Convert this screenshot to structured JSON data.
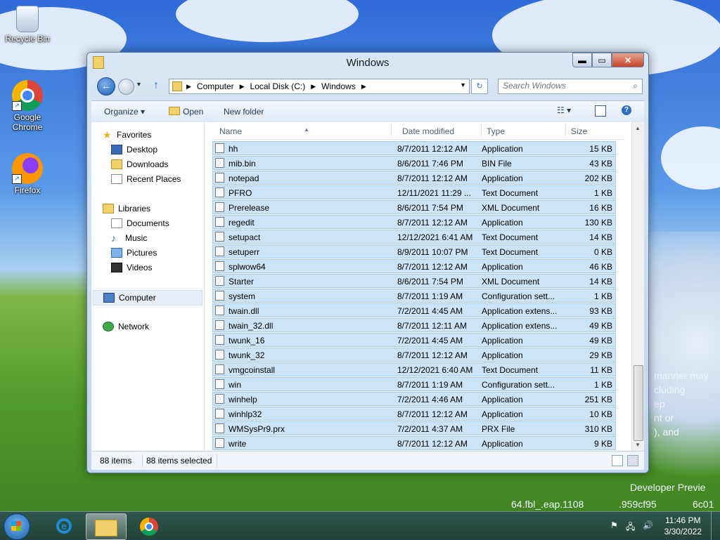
{
  "desktop": {
    "icons": [
      {
        "label": "Recycle Bin"
      },
      {
        "label": "Google Chrome"
      },
      {
        "label": "Firefox"
      }
    ],
    "watermark": {
      "lines": [
        "manner may",
        "cluding",
        "ep",
        "nt or",
        "), and"
      ],
      "build_line1": "Developer Previe",
      "build_line2": "64.fbl_.eap.1108",
      "build_line3": ".959cf95",
      "build_line4": "6c01"
    }
  },
  "window": {
    "title": "Windows",
    "controls": {
      "minimize": "▬",
      "maximize": "▭",
      "close": "✕"
    },
    "address": {
      "crumbs": [
        "Computer",
        "Local Disk (C:)",
        "Windows"
      ]
    },
    "search": {
      "placeholder": "Search Windows"
    },
    "toolbar": {
      "organize": "Organize ▾",
      "open": "Open",
      "new_folder": "New folder",
      "views": "☷ ▾",
      "help": "?"
    },
    "nav": {
      "favorites": "Favorites",
      "desktop": "Desktop",
      "downloads": "Downloads",
      "recent_places": "Recent Places",
      "libraries": "Libraries",
      "documents": "Documents",
      "music": "Music",
      "pictures": "Pictures",
      "videos": "Videos",
      "computer": "Computer",
      "network": "Network"
    },
    "columns": {
      "name": "Name",
      "date": "Date modified",
      "type": "Type",
      "size": "Size"
    },
    "files": [
      {
        "name": "hh",
        "date": "8/7/2011 12:12 AM",
        "type": "Application",
        "size": "15 KB"
      },
      {
        "name": "mib.bin",
        "date": "8/6/2011 7:46 PM",
        "type": "BIN File",
        "size": "43 KB"
      },
      {
        "name": "notepad",
        "date": "8/7/2011 12:12 AM",
        "type": "Application",
        "size": "202 KB"
      },
      {
        "name": "PFRO",
        "date": "12/11/2021 11:29 ...",
        "type": "Text Document",
        "size": "1 KB"
      },
      {
        "name": "Prerelease",
        "date": "8/6/2011 7:54 PM",
        "type": "XML Document",
        "size": "16 KB"
      },
      {
        "name": "regedit",
        "date": "8/7/2011 12:12 AM",
        "type": "Application",
        "size": "130 KB"
      },
      {
        "name": "setupact",
        "date": "12/12/2021 6:41 AM",
        "type": "Text Document",
        "size": "14 KB"
      },
      {
        "name": "setuperr",
        "date": "8/9/2011 10:07 PM",
        "type": "Text Document",
        "size": "0 KB"
      },
      {
        "name": "splwow64",
        "date": "8/7/2011 12:12 AM",
        "type": "Application",
        "size": "46 KB"
      },
      {
        "name": "Starter",
        "date": "8/6/2011 7:54 PM",
        "type": "XML Document",
        "size": "14 KB"
      },
      {
        "name": "system",
        "date": "8/7/2011 1:19 AM",
        "type": "Configuration sett...",
        "size": "1 KB"
      },
      {
        "name": "twain.dll",
        "date": "7/2/2011 4:45 AM",
        "type": "Application extens...",
        "size": "93 KB"
      },
      {
        "name": "twain_32.dll",
        "date": "8/7/2011 12:11 AM",
        "type": "Application extens...",
        "size": "49 KB"
      },
      {
        "name": "twunk_16",
        "date": "7/2/2011 4:45 AM",
        "type": "Application",
        "size": "49 KB"
      },
      {
        "name": "twunk_32",
        "date": "8/7/2011 12:12 AM",
        "type": "Application",
        "size": "29 KB"
      },
      {
        "name": "vmgcoinstall",
        "date": "12/12/2021 6:40 AM",
        "type": "Text Document",
        "size": "11 KB"
      },
      {
        "name": "win",
        "date": "8/7/2011 1:19 AM",
        "type": "Configuration sett...",
        "size": "1 KB"
      },
      {
        "name": "winhelp",
        "date": "7/2/2011 4:46 AM",
        "type": "Application",
        "size": "251 KB"
      },
      {
        "name": "winhlp32",
        "date": "8/7/2011 12:12 AM",
        "type": "Application",
        "size": "10 KB"
      },
      {
        "name": "WMSysPr9.prx",
        "date": "7/2/2011 4:37 AM",
        "type": "PRX File",
        "size": "310 KB"
      },
      {
        "name": "write",
        "date": "8/7/2011 12:12 AM",
        "type": "Application",
        "size": "9 KB"
      }
    ],
    "status": {
      "count": "88 items",
      "selected": "88 items selected"
    }
  },
  "taskbar": {
    "clock_time": "11:46 PM",
    "clock_date": "3/30/2022",
    "tray": {
      "flag": "⚑",
      "network": "🖧",
      "volume": "🔊"
    }
  }
}
